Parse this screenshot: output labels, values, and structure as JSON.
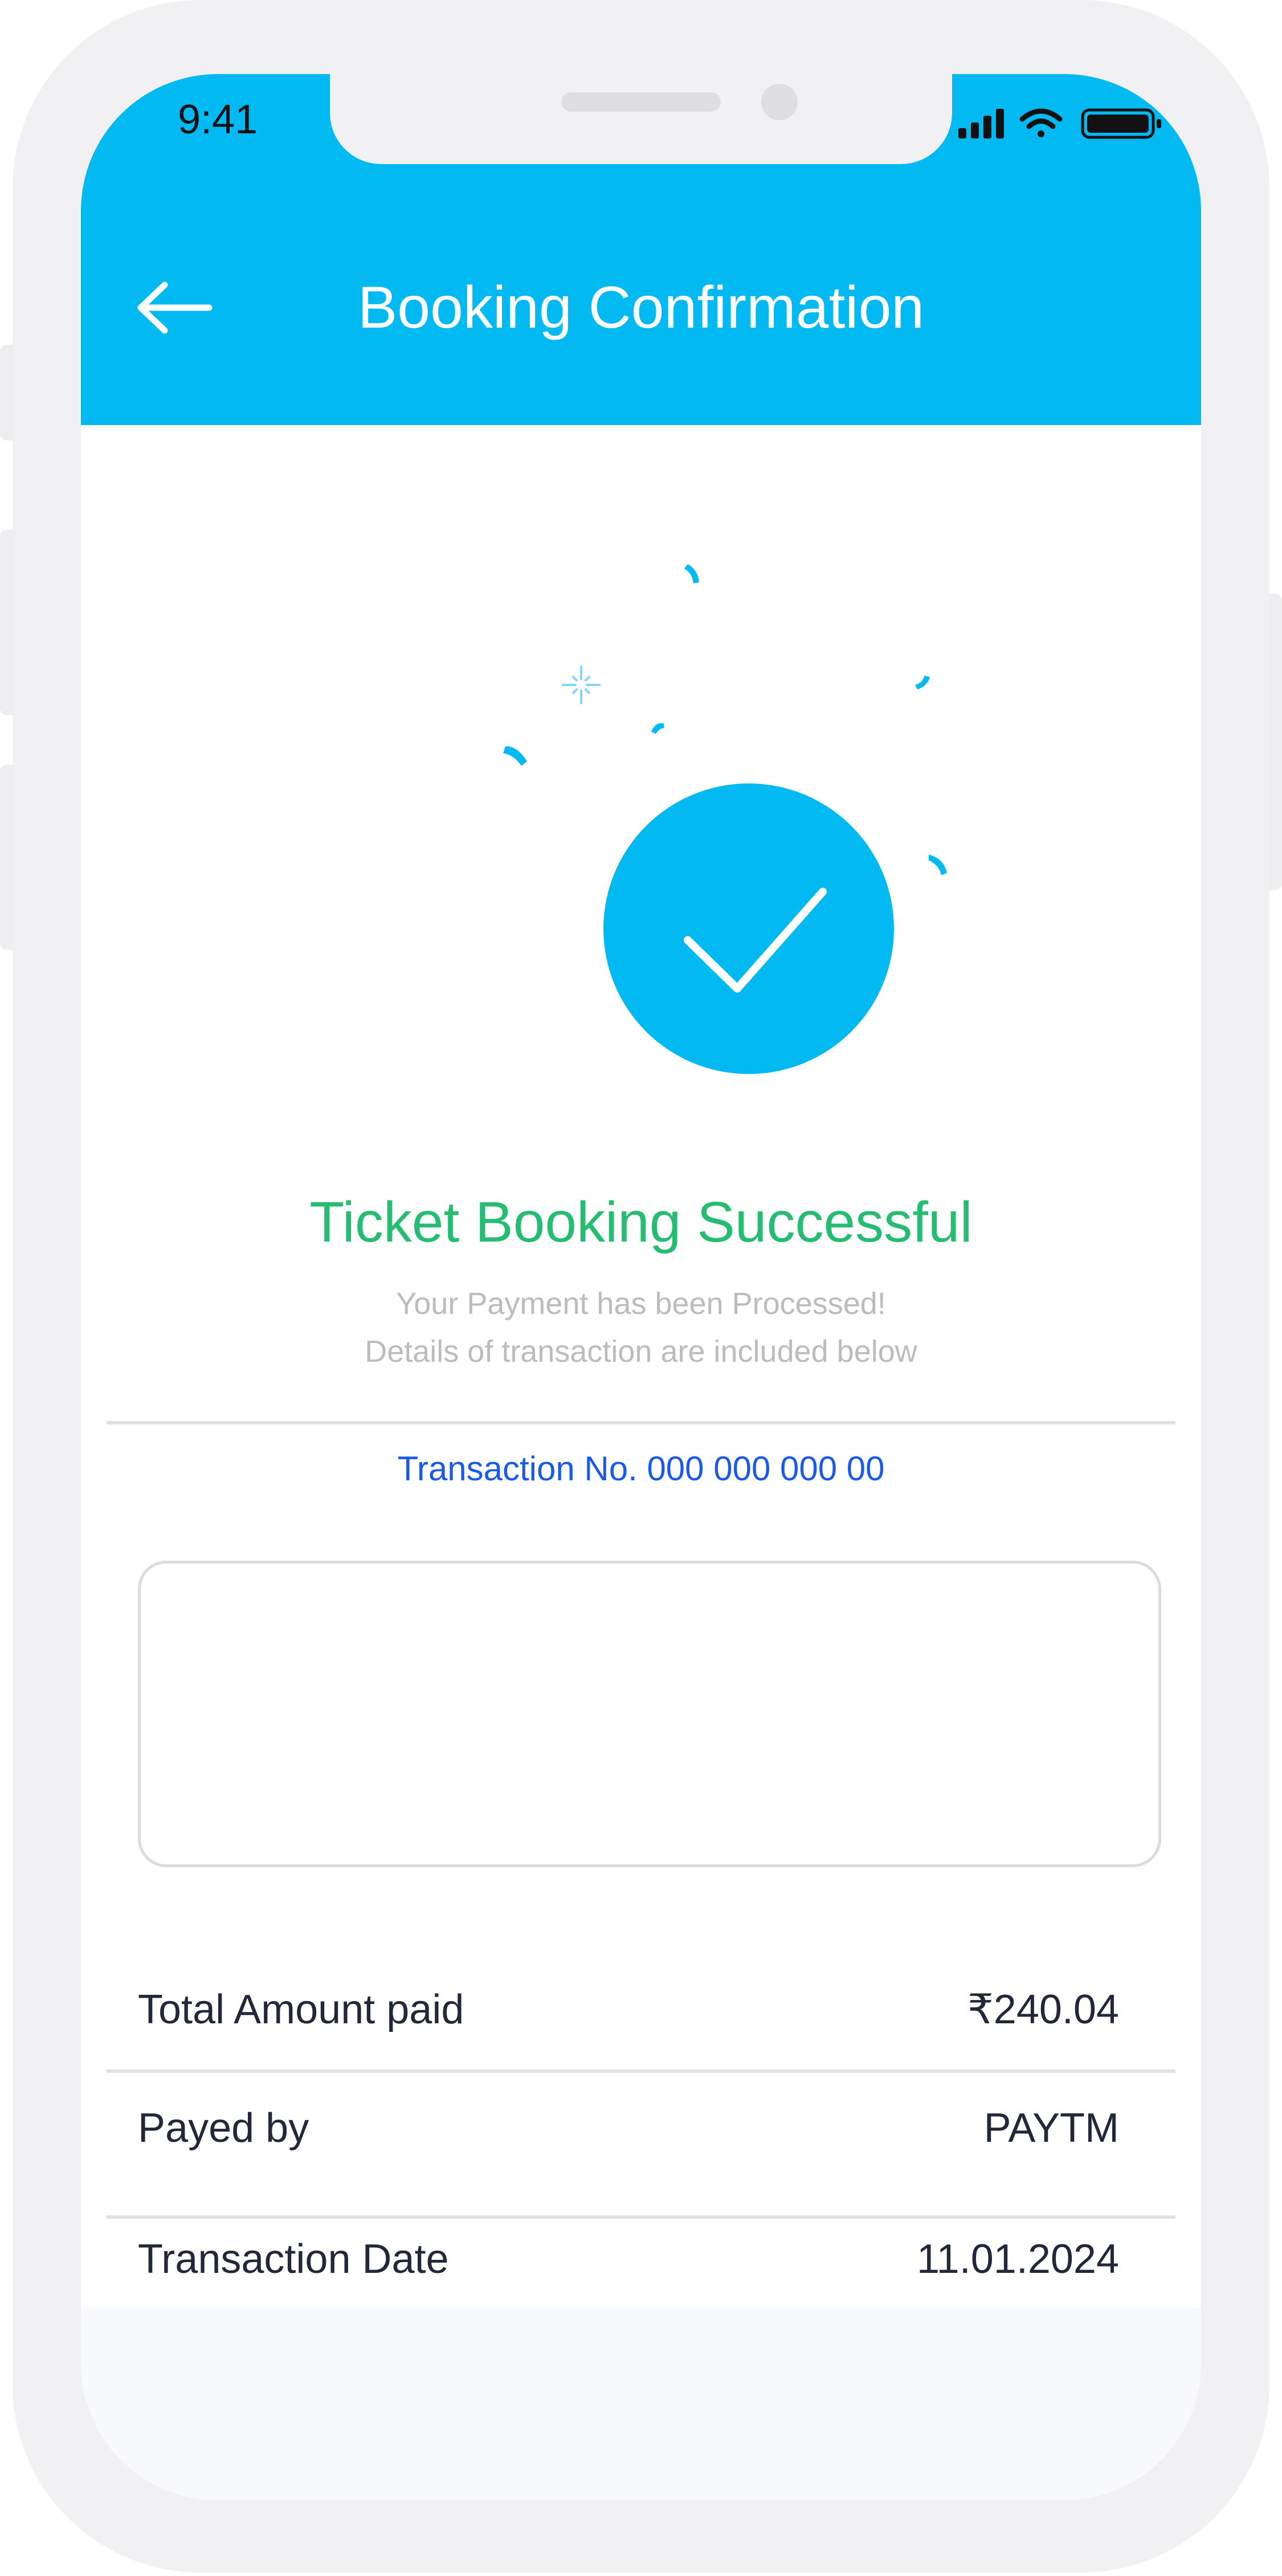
{
  "status_bar": {
    "time": "9:41"
  },
  "header": {
    "title": "Booking Confirmation"
  },
  "confirmation": {
    "heading": "Ticket Booking Successful",
    "subtitle_line1": "Your Payment has been Processed!",
    "subtitle_line2": "Details of transaction are included below",
    "transaction_label": "Transaction No.",
    "transaction_number": "000 000 000 00"
  },
  "details": [
    {
      "label": "Total Amount paid",
      "value": "₹240.04"
    },
    {
      "label": "Payed by",
      "value": "PAYTM"
    },
    {
      "label": "Transaction Date",
      "value": "11.01.2024"
    }
  ],
  "colors": {
    "header": "#03b9f2",
    "success_text": "#26bd72",
    "link_blue": "#1a5ae8",
    "frame": "#f1f1f3"
  },
  "icons": [
    "back-arrow-icon",
    "signal-icon",
    "wifi-icon",
    "battery-icon",
    "check-icon",
    "confetti-icon",
    "sparkle-icon"
  ]
}
